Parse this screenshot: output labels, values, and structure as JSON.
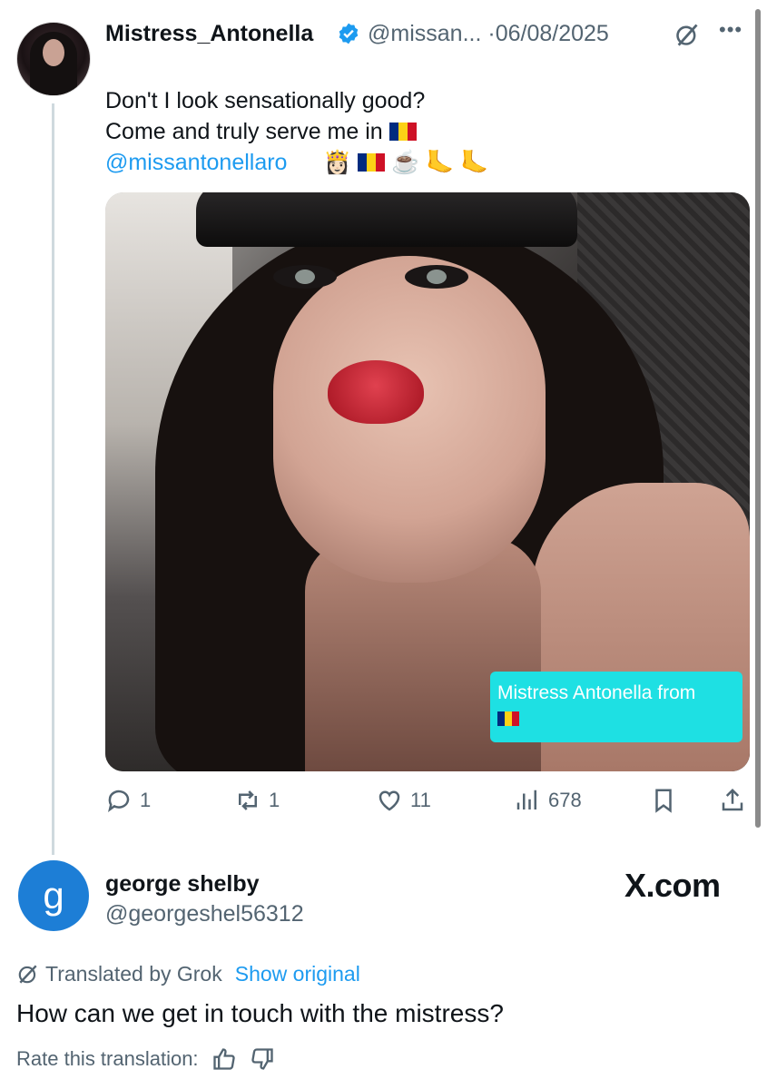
{
  "post": {
    "author_name": "Mistress_Antonella",
    "author_handle": "@missan...",
    "date_sep": "·",
    "date": "06/08/2025",
    "text": "Don't I look sensationally good?\nCome and truly serve me in",
    "mention": "@missantonellaro",
    "emojis": [
      "👸🏻",
      "flag-romania",
      "☕",
      "🦶",
      "🦶"
    ],
    "media": {
      "overlay_label": "Mistress Antonella from"
    },
    "actions": {
      "replies": "1",
      "reposts": "1",
      "likes": "11",
      "views": "678"
    }
  },
  "reply": {
    "avatar_letter": "g",
    "author_name": "george shelby",
    "author_handle": "@georgeshel56312",
    "watermark": "X.com",
    "translated_label": "Translated by Grok",
    "show_original": "Show original",
    "text": "How can we get in touch with the mistress?",
    "rate_label": "Rate this translation:"
  },
  "colors": {
    "link": "#1d9bf0",
    "muted": "#536471",
    "verified": "#1d9bf0",
    "reply_avatar": "#1d7ed6",
    "overlay_label_bg": "#1ee0e3"
  },
  "icons": [
    "verified-badge-icon",
    "grok-icon",
    "more-icon",
    "reply-icon",
    "repost-icon",
    "like-icon",
    "views-icon",
    "bookmark-icon",
    "share-icon",
    "thumbs-up-icon",
    "thumbs-down-icon"
  ]
}
